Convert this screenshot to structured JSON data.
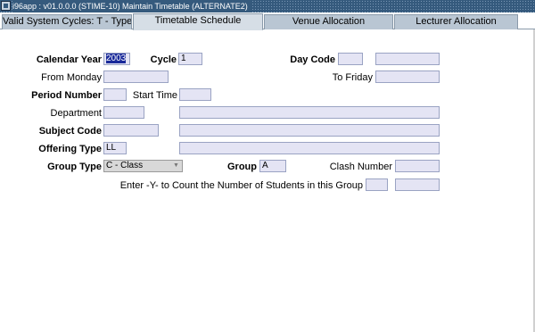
{
  "window": {
    "title": "i96app : v01.0.0.0 (STIME-10) Maintain Timetable  (ALTERNATE2)"
  },
  "tabs": [
    {
      "label": "Valid System Cycles: T - Type"
    },
    {
      "label": "Timetable Schedule"
    },
    {
      "label": "Venue Allocation"
    },
    {
      "label": "Lecturer Allocation"
    }
  ],
  "active_tab": "Timetable Schedule",
  "form": {
    "calendar_year": {
      "label": "Calendar Year",
      "value": "2003"
    },
    "cycle": {
      "label": "Cycle",
      "value": "1"
    },
    "day_code": {
      "label": "Day Code",
      "value": "",
      "desc": ""
    },
    "from_monday": {
      "label": "From Monday",
      "value": ""
    },
    "to_friday": {
      "label": "To Friday",
      "value": ""
    },
    "period_number": {
      "label": "Period Number",
      "value": ""
    },
    "start_time": {
      "label": "Start Time",
      "value": ""
    },
    "department": {
      "label": "Department",
      "value": "",
      "desc": ""
    },
    "subject_code": {
      "label": "Subject Code",
      "value": "",
      "desc": ""
    },
    "offering_type": {
      "label": "Offering Type",
      "value": "LL",
      "desc": ""
    },
    "group_type": {
      "label": "Group Type",
      "value": "C - Class"
    },
    "group": {
      "label": "Group",
      "value": "A"
    },
    "clash_number": {
      "label": "Clash Number",
      "value": ""
    },
    "count_students": {
      "label": "Enter -Y- to Count the Number of Students in this Group",
      "value": "",
      "result": ""
    }
  }
}
